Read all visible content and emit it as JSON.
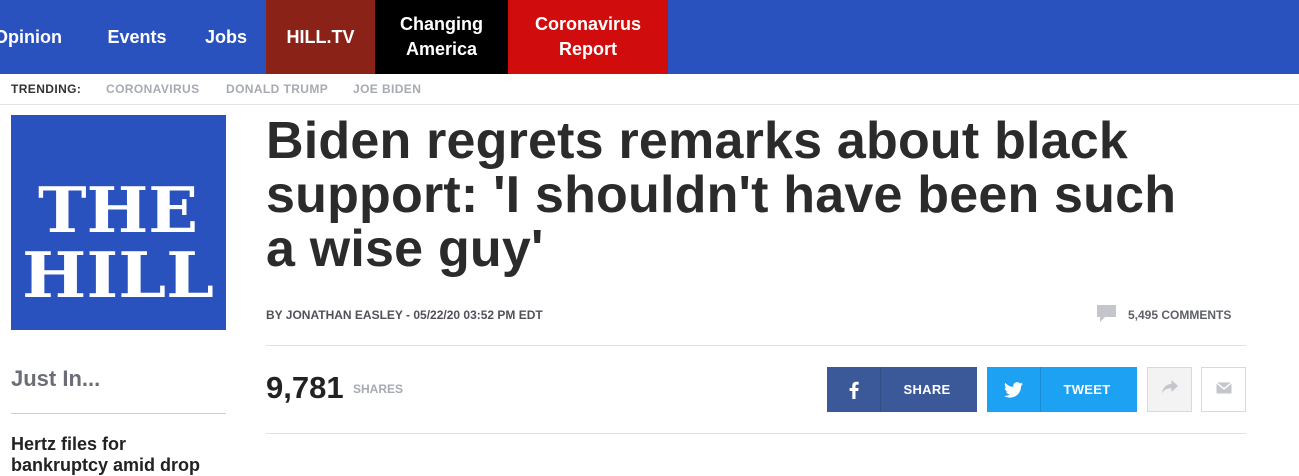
{
  "nav": {
    "opinion": "Opinion",
    "events": "Events",
    "jobs": "Jobs",
    "hilltv": "HILL.TV",
    "changing_line1": "Changing",
    "changing_line2": "America",
    "corona_line1": "Coronavirus",
    "corona_line2": "Report"
  },
  "trending": {
    "label": "TRENDING:",
    "items": [
      "CORONAVIRUS",
      "DONALD TRUMP",
      "JOE BIDEN"
    ]
  },
  "logo": {
    "line1": "THE",
    "line2": "HILL"
  },
  "sidebar": {
    "just_in": "Just In...",
    "story_line1": "Hertz files for",
    "story_line2": "bankruptcy amid drop"
  },
  "article": {
    "headline_line1": "Biden regrets remarks about black",
    "headline_line2": "support: 'I shouldn't have been such",
    "headline_line3": "a wise guy'",
    "byline": "BY JONATHAN EASLEY - 05/22/20 03:52 PM EDT",
    "comments_count": "5,495",
    "comments_label": "COMMENTS",
    "shares_count": "9,781",
    "shares_label": "SHARES",
    "share_button": "SHARE",
    "tweet_button": "TWEET"
  },
  "colors": {
    "nav_blue": "#2a52be",
    "hilltv_red": "#8b2218",
    "changing_black": "#000000",
    "corona_red": "#d00c0c",
    "facebook": "#3b5998",
    "twitter": "#1da1f2"
  },
  "icons": [
    "facebook-icon",
    "twitter-icon",
    "forward-icon",
    "mail-icon",
    "comment-icon"
  ]
}
